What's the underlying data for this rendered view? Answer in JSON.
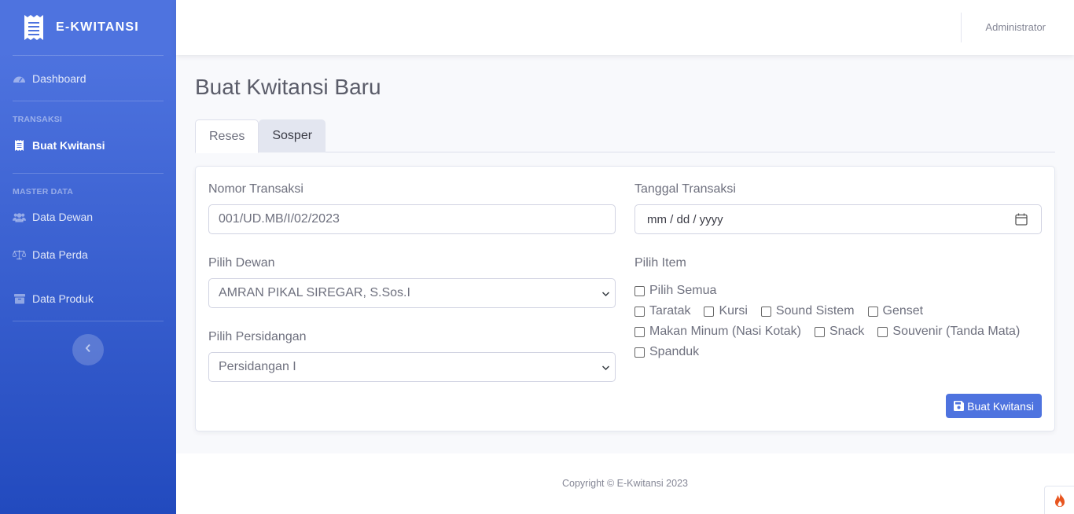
{
  "brand": {
    "name": "E-KWITANSI",
    "icon": "receipt-icon"
  },
  "sidebar": {
    "dashboard": {
      "label": "Dashboard",
      "icon": "tachometer-icon"
    },
    "heading_transaksi": "TRANSAKSI",
    "buat_kwitansi": {
      "label": "Buat Kwitansi",
      "icon": "receipt-icon"
    },
    "heading_master": "MASTER DATA",
    "data_dewan": {
      "label": "Data Dewan",
      "icon": "users-icon"
    },
    "data_perda": {
      "label": "Data Perda",
      "icon": "balance-scale-icon"
    },
    "data_produk": {
      "label": "Data Produk",
      "icon": "box-icon"
    },
    "toggle_icon": "chevron-left-icon"
  },
  "topbar": {
    "user_name": "Administrator"
  },
  "page": {
    "title": "Buat Kwitansi Baru"
  },
  "tabs": [
    {
      "label": "Reses",
      "active": true
    },
    {
      "label": "Sosper",
      "active": false
    }
  ],
  "form": {
    "nomor_transaksi": {
      "label": "Nomor Transaksi",
      "value": "001/UD.MB/I/02/2023"
    },
    "tanggal_transaksi": {
      "label": "Tanggal Transaksi",
      "placeholder": "mm / dd / yyyy"
    },
    "pilih_dewan": {
      "label": "Pilih Dewan",
      "value": "AMRAN PIKAL SIREGAR, S.Sos.I"
    },
    "pilih_persidangan": {
      "label": "Pilih Persidangan",
      "value": "Persidangan I"
    },
    "pilih_item": {
      "label": "Pilih Item",
      "select_all": "Pilih Semua",
      "items": [
        "Taratak",
        "Kursi",
        "Sound Sistem",
        "Genset",
        "Makan Minum (Nasi Kotak)",
        "Snack",
        "Souvenir (Tanda Mata)",
        "Spanduk"
      ]
    },
    "submit_label": "Buat Kwitansi"
  },
  "footer": {
    "copyright": "Copyright © E-Kwitansi 2023"
  },
  "colors": {
    "primary": "#4e73df",
    "primary_dark": "#224abe",
    "text": "#5a5c69"
  }
}
